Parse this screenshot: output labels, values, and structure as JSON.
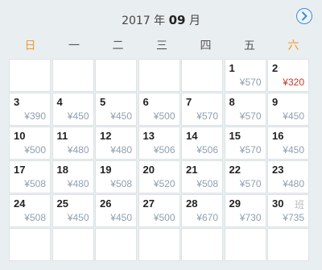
{
  "header": {
    "year": "2017",
    "year_suffix": "年",
    "month": "09",
    "month_suffix": "月"
  },
  "weekdays": [
    "日",
    "一",
    "二",
    "三",
    "四",
    "五",
    "六"
  ],
  "weekend_color": "#f39a2d",
  "lowest_price_color": "#c0392b",
  "next_icon": "chevron-right-circle-icon",
  "cells": [
    {
      "day": "",
      "price": ""
    },
    {
      "day": "",
      "price": ""
    },
    {
      "day": "",
      "price": ""
    },
    {
      "day": "",
      "price": ""
    },
    {
      "day": "",
      "price": ""
    },
    {
      "day": "1",
      "price": "¥570"
    },
    {
      "day": "2",
      "price": "¥320",
      "lowest": true
    },
    {
      "day": "3",
      "price": "¥390"
    },
    {
      "day": "4",
      "price": "¥450"
    },
    {
      "day": "5",
      "price": "¥450"
    },
    {
      "day": "6",
      "price": "¥500"
    },
    {
      "day": "7",
      "price": "¥570"
    },
    {
      "day": "8",
      "price": "¥570"
    },
    {
      "day": "9",
      "price": "¥450"
    },
    {
      "day": "10",
      "price": "¥500"
    },
    {
      "day": "11",
      "price": "¥480"
    },
    {
      "day": "12",
      "price": "¥480"
    },
    {
      "day": "13",
      "price": "¥506"
    },
    {
      "day": "14",
      "price": "¥506"
    },
    {
      "day": "15",
      "price": "¥570"
    },
    {
      "day": "16",
      "price": "¥450"
    },
    {
      "day": "17",
      "price": "¥508"
    },
    {
      "day": "18",
      "price": "¥480"
    },
    {
      "day": "19",
      "price": "¥508"
    },
    {
      "day": "20",
      "price": "¥520"
    },
    {
      "day": "21",
      "price": "¥508"
    },
    {
      "day": "22",
      "price": "¥570"
    },
    {
      "day": "23",
      "price": "¥480"
    },
    {
      "day": "24",
      "price": "¥508"
    },
    {
      "day": "25",
      "price": "¥450"
    },
    {
      "day": "26",
      "price": "¥450"
    },
    {
      "day": "27",
      "price": "¥500"
    },
    {
      "day": "28",
      "price": "¥670"
    },
    {
      "day": "29",
      "price": "¥730"
    },
    {
      "day": "30",
      "price": "¥735",
      "tag": "班"
    },
    {
      "day": "",
      "price": ""
    },
    {
      "day": "",
      "price": ""
    },
    {
      "day": "",
      "price": ""
    },
    {
      "day": "",
      "price": ""
    },
    {
      "day": "",
      "price": ""
    },
    {
      "day": "",
      "price": ""
    },
    {
      "day": "",
      "price": ""
    }
  ]
}
